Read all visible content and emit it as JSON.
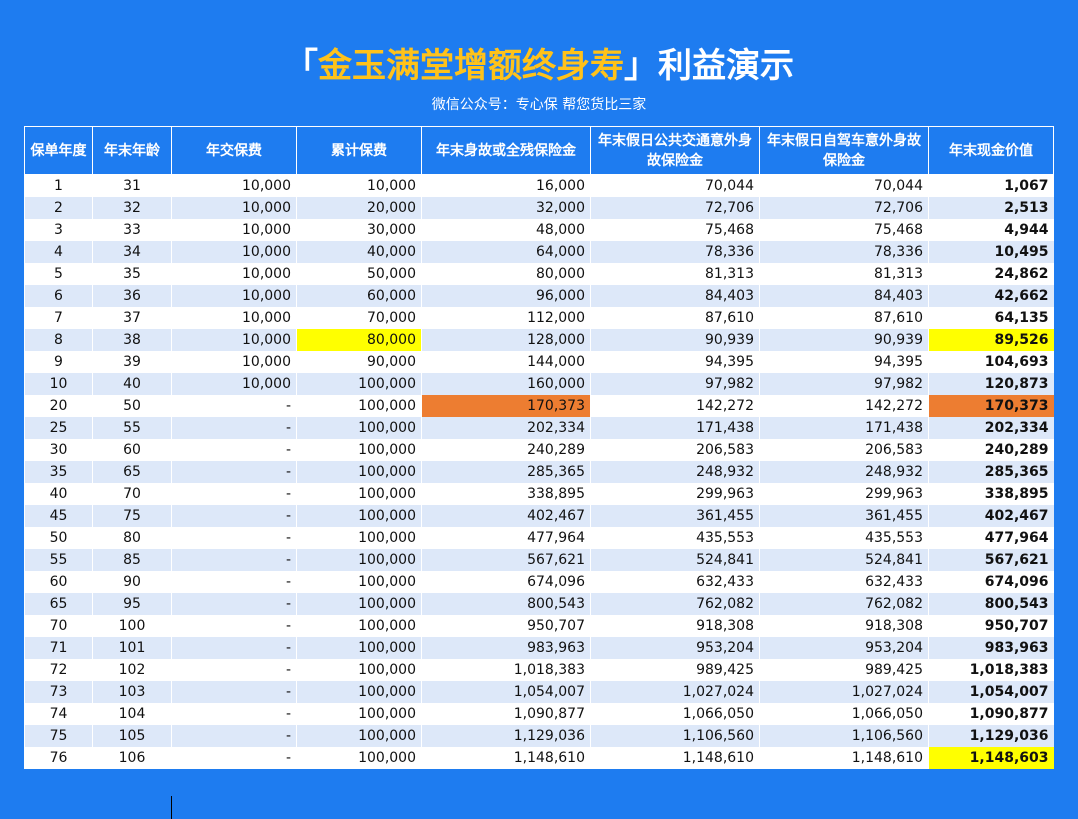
{
  "title": {
    "open": "「",
    "highlight": "金玉满堂增额终身寿",
    "close": "」利益演示"
  },
  "subtitle": "微信公众号：专心保 帮您货比三家",
  "colors": {
    "background": "#1e7cf0",
    "title_highlight": "#ffc21a",
    "row_alt": "#dde8f9",
    "highlight_yellow": "#ffff00",
    "highlight_orange": "#ed7d31"
  },
  "headers": [
    "保单年度",
    "年末年龄",
    "年交保费",
    "累计保费",
    "年末身故或全残保险金",
    "年末假日公共交通意外身故保险金",
    "年末假日自驾车意外身故保险金",
    "年末现金价值"
  ],
  "rows": [
    [
      "1",
      "31",
      "10,000",
      "10,000",
      "16,000",
      "70,044",
      "70,044",
      "1,067"
    ],
    [
      "2",
      "32",
      "10,000",
      "20,000",
      "32,000",
      "72,706",
      "72,706",
      "2,513"
    ],
    [
      "3",
      "33",
      "10,000",
      "30,000",
      "48,000",
      "75,468",
      "75,468",
      "4,944"
    ],
    [
      "4",
      "34",
      "10,000",
      "40,000",
      "64,000",
      "78,336",
      "78,336",
      "10,495"
    ],
    [
      "5",
      "35",
      "10,000",
      "50,000",
      "80,000",
      "81,313",
      "81,313",
      "24,862"
    ],
    [
      "6",
      "36",
      "10,000",
      "60,000",
      "96,000",
      "84,403",
      "84,403",
      "42,662"
    ],
    [
      "7",
      "37",
      "10,000",
      "70,000",
      "112,000",
      "87,610",
      "87,610",
      "64,135"
    ],
    [
      "8",
      "38",
      "10,000",
      "80,000",
      "128,000",
      "90,939",
      "90,939",
      "89,526"
    ],
    [
      "9",
      "39",
      "10,000",
      "90,000",
      "144,000",
      "94,395",
      "94,395",
      "104,693"
    ],
    [
      "10",
      "40",
      "10,000",
      "100,000",
      "160,000",
      "97,982",
      "97,982",
      "120,873"
    ],
    [
      "20",
      "50",
      "-",
      "100,000",
      "170,373",
      "142,272",
      "142,272",
      "170,373"
    ],
    [
      "25",
      "55",
      "-",
      "100,000",
      "202,334",
      "171,438",
      "171,438",
      "202,334"
    ],
    [
      "30",
      "60",
      "-",
      "100,000",
      "240,289",
      "206,583",
      "206,583",
      "240,289"
    ],
    [
      "35",
      "65",
      "-",
      "100,000",
      "285,365",
      "248,932",
      "248,932",
      "285,365"
    ],
    [
      "40",
      "70",
      "-",
      "100,000",
      "338,895",
      "299,963",
      "299,963",
      "338,895"
    ],
    [
      "45",
      "75",
      "-",
      "100,000",
      "402,467",
      "361,455",
      "361,455",
      "402,467"
    ],
    [
      "50",
      "80",
      "-",
      "100,000",
      "477,964",
      "435,553",
      "435,553",
      "477,964"
    ],
    [
      "55",
      "85",
      "-",
      "100,000",
      "567,621",
      "524,841",
      "524,841",
      "567,621"
    ],
    [
      "60",
      "90",
      "-",
      "100,000",
      "674,096",
      "632,433",
      "632,433",
      "674,096"
    ],
    [
      "65",
      "95",
      "-",
      "100,000",
      "800,543",
      "762,082",
      "762,082",
      "800,543"
    ],
    [
      "70",
      "100",
      "-",
      "100,000",
      "950,707",
      "918,308",
      "918,308",
      "950,707"
    ],
    [
      "71",
      "101",
      "-",
      "100,000",
      "983,963",
      "953,204",
      "953,204",
      "983,963"
    ],
    [
      "72",
      "102",
      "-",
      "100,000",
      "1,018,383",
      "989,425",
      "989,425",
      "1,018,383"
    ],
    [
      "73",
      "103",
      "-",
      "100,000",
      "1,054,007",
      "1,027,024",
      "1,027,024",
      "1,054,007"
    ],
    [
      "74",
      "104",
      "-",
      "100,000",
      "1,090,877",
      "1,066,050",
      "1,066,050",
      "1,090,877"
    ],
    [
      "75",
      "105",
      "-",
      "100,000",
      "1,129,036",
      "1,106,560",
      "1,106,560",
      "1,129,036"
    ],
    [
      "76",
      "106",
      "-",
      "100,000",
      "1,148,610",
      "1,148,610",
      "1,148,610",
      "1,148,603"
    ]
  ],
  "highlights": [
    {
      "row": 7,
      "col": 3,
      "color": "yellow"
    },
    {
      "row": 7,
      "col": 7,
      "color": "yellow"
    },
    {
      "row": 10,
      "col": 4,
      "color": "orange"
    },
    {
      "row": 10,
      "col": 7,
      "color": "orange"
    },
    {
      "row": 26,
      "col": 7,
      "color": "yellow"
    }
  ]
}
